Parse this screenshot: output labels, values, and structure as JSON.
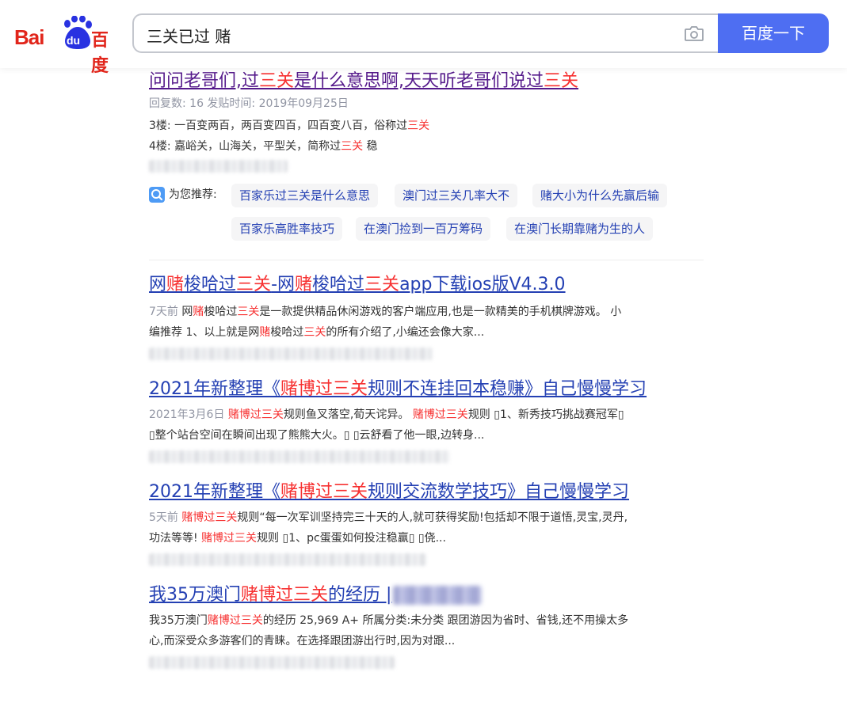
{
  "header": {
    "logo_bai": "Bai",
    "logo_du": "du",
    "logo_cn": "百度",
    "search_value": "三关已过 赌",
    "search_button": "百度一下",
    "camera_icon": "camera-icon"
  },
  "results": [
    {
      "title": [
        {
          "t": "问问老哥们,过",
          "em": false
        },
        {
          "t": "三关",
          "em": true
        },
        {
          "t": "是什么意思啊,天天听老哥们说过",
          "em": false
        },
        {
          "t": "三关",
          "em": true
        }
      ],
      "meta": "回复数: 16 发贴时间: 2019年09月25日",
      "line1": [
        {
          "t": "3楼: 一百变两百，两百变四百，四百变八百，俗称过",
          "em": false
        },
        {
          "t": "三关",
          "em": true
        }
      ],
      "line2": [
        {
          "t": "4楼: 嘉峪关，山海关，平型关，简称过",
          "em": false
        },
        {
          "t": "三关",
          "em": true
        },
        {
          "t": " 稳",
          "em": false
        }
      ]
    },
    {
      "title": [
        {
          "t": "网",
          "em": false
        },
        {
          "t": "赌",
          "em": true
        },
        {
          "t": "梭哈过",
          "em": false
        },
        {
          "t": "三关",
          "em": true
        },
        {
          "t": "-网",
          "em": false
        },
        {
          "t": "赌",
          "em": true
        },
        {
          "t": "梭哈过",
          "em": false
        },
        {
          "t": "三关",
          "em": true
        },
        {
          "t": "app下载ios版V4.3.0",
          "em": false
        }
      ],
      "date": "7天前 ",
      "line1": [
        {
          "t": "网",
          "em": false
        },
        {
          "t": "赌",
          "em": true
        },
        {
          "t": "梭哈过",
          "em": false
        },
        {
          "t": "三关",
          "em": true
        },
        {
          "t": "是一款提供精品休闲游戏的客户端应用,也是一款精美的手机棋牌游戏。 小",
          "em": false
        }
      ],
      "line2": [
        {
          "t": "编推荐 1、以上就是网",
          "em": false
        },
        {
          "t": "赌",
          "em": true
        },
        {
          "t": "梭哈过",
          "em": false
        },
        {
          "t": "三关",
          "em": true
        },
        {
          "t": "的所有介绍了,小编还会像大家...",
          "em": false
        }
      ]
    },
    {
      "title": [
        {
          "t": "2021年新整理《",
          "em": false
        },
        {
          "t": "赌博过三关",
          "em": true
        },
        {
          "t": "规则不连挂回本稳赚》自己慢慢学习",
          "em": false
        }
      ],
      "date": "2021年3月6日 ",
      "line1": [
        {
          "t": "赌博过三关",
          "em": true
        },
        {
          "t": "规则鱼叉落空,荀天诧异。 ",
          "em": false
        },
        {
          "t": "赌博过三关",
          "em": true
        },
        {
          "t": "规则 ▯1、新秀技巧挑战赛冠军▯",
          "em": false
        }
      ],
      "line2": [
        {
          "t": "▯整个站台空间在瞬间出现了熊熊大火。▯ ▯云舒看了他一眼,边转身...",
          "em": false
        }
      ]
    },
    {
      "title": [
        {
          "t": "2021年新整理《",
          "em": false
        },
        {
          "t": "赌博过三关",
          "em": true
        },
        {
          "t": "规则交流数学技巧》自己慢慢学习",
          "em": false
        }
      ],
      "date": "5天前 ",
      "line1": [
        {
          "t": "赌博过三关",
          "em": true
        },
        {
          "t": "规则“每一次军训坚持完三十天的人,就可获得奖励!包括却不限于道悟,灵宝,灵丹,",
          "em": false
        }
      ],
      "line2": [
        {
          "t": "功法等等! ",
          "em": false
        },
        {
          "t": "赌博过三关",
          "em": true
        },
        {
          "t": "规则 ▯1、pc蛋蛋如何投注稳赢▯ ▯侥...",
          "em": false
        }
      ]
    },
    {
      "title": [
        {
          "t": "我35万澳门",
          "em": false
        },
        {
          "t": "赌博过三关",
          "em": true
        },
        {
          "t": "的经历 | ",
          "em": false
        }
      ],
      "line1": [
        {
          "t": "我35万澳门",
          "em": false
        },
        {
          "t": "赌博过三关",
          "em": true
        },
        {
          "t": "的经历 25,969 A+ 所属分类:未分类 跟团游因为省时、省钱,还不用操太多",
          "em": false
        }
      ],
      "line2": [
        {
          "t": "心,而深受众多游客们的青睐。在选择跟团游出行时,因为对跟...",
          "em": false
        }
      ]
    }
  ],
  "recommend": {
    "label": "为您推荐:",
    "chips": [
      "百家乐过三关是什么意思",
      "澳门过三关几率大不",
      "赌大小为什么先赢后输",
      "百家乐高胜率技巧",
      "在澳门捡到一百万筹码",
      "在澳门长期靠赌为生的人"
    ]
  },
  "colors": {
    "accent": "#4e6ef2",
    "link": "#2440b3",
    "visited": "#551a8b",
    "highlight": "#f73131",
    "logo_red": "#e1251b",
    "logo_blue": "#2932e1"
  }
}
